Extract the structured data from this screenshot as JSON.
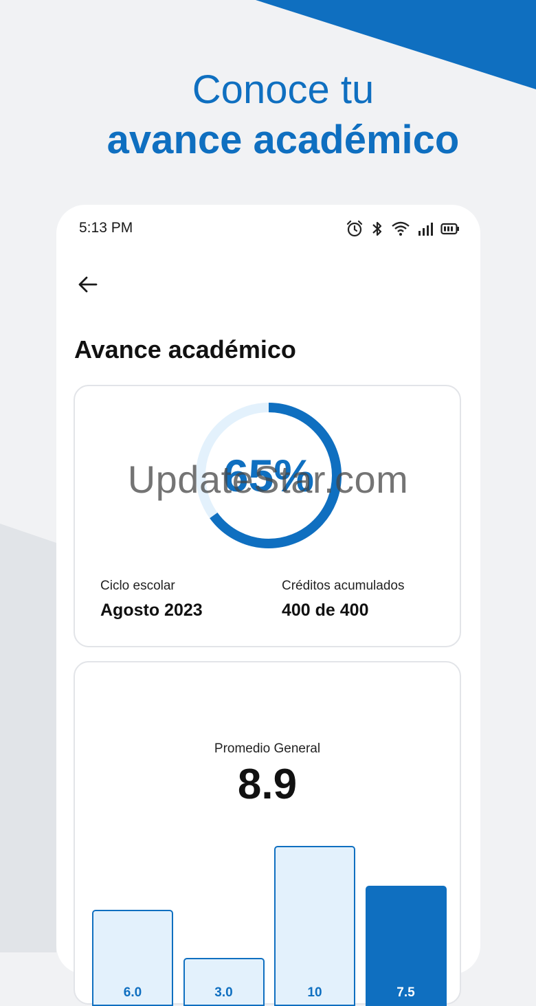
{
  "headline": {
    "line1": "Conoce tu",
    "line2": "avance académico"
  },
  "status_bar": {
    "time": "5:13 PM"
  },
  "page": {
    "title": "Avance académico"
  },
  "progress": {
    "label": "65%",
    "value": 0.65
  },
  "stats": {
    "cycle_label": "Ciclo escolar",
    "cycle_value": "Agosto 2023",
    "credits_label": "Créditos acumulados",
    "credits_value": "400 de 400"
  },
  "average": {
    "label": "Promedio General",
    "value": "8.9"
  },
  "chart_data": {
    "type": "bar",
    "categories": [
      "",
      "",
      "",
      ""
    ],
    "values": [
      6.0,
      3.0,
      10,
      7.5
    ],
    "value_labels": [
      "6.0",
      "3.0",
      "10",
      "7.5"
    ],
    "highlighted_index": 3,
    "title": "",
    "xlabel": "",
    "ylabel": "",
    "ylim": [
      0,
      10
    ]
  },
  "watermark": "UpdateStar.com",
  "colors": {
    "accent": "#0f6fc0",
    "bar_fill": "#e3f1fc",
    "background": "#f1f2f4"
  },
  "icons": [
    "alarm-icon",
    "bluetooth-icon",
    "wifi-icon",
    "signal-icon",
    "battery-icon",
    "back-arrow-icon"
  ]
}
